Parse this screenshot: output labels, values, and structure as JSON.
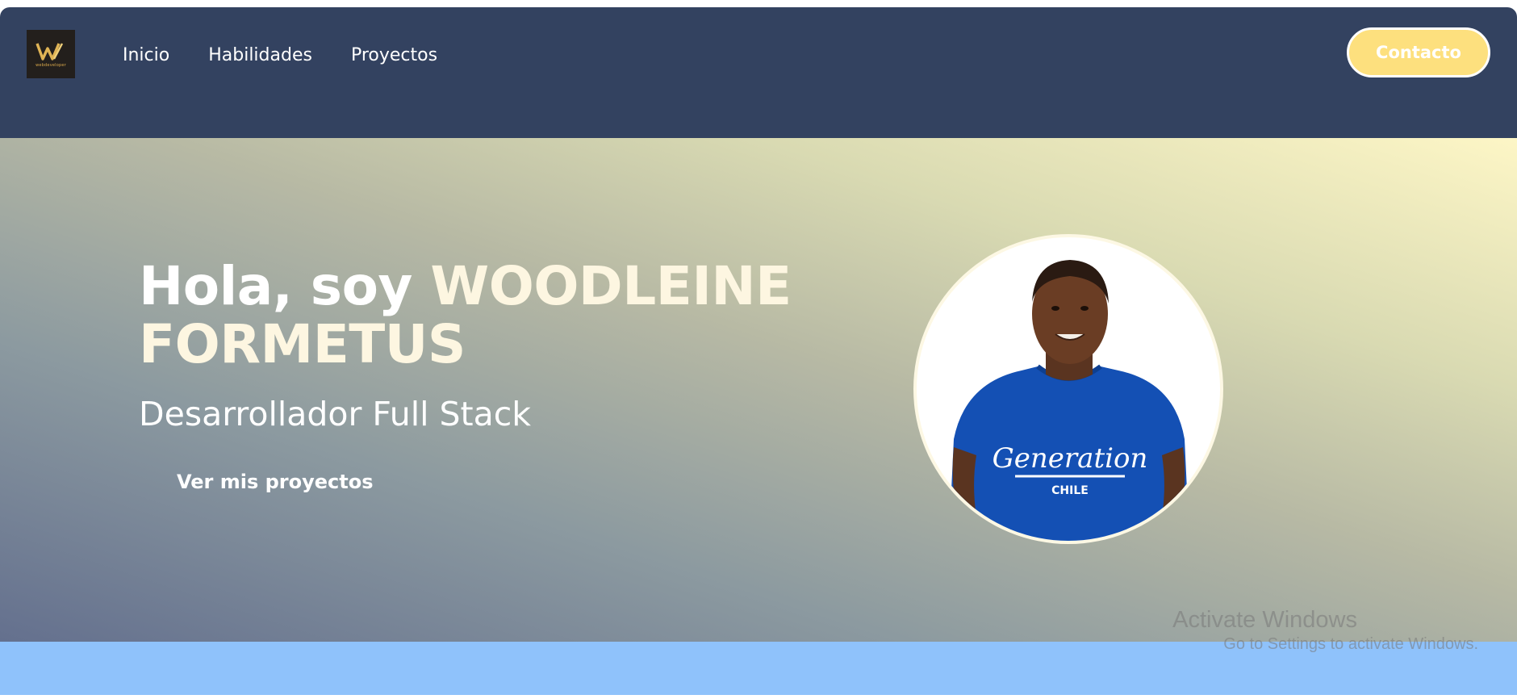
{
  "nav": {
    "logo_icon": "webdeveloper-logo",
    "logo_text": "webdeveloper",
    "links": [
      "Inicio",
      "Habilidades",
      "Proyectos"
    ],
    "contact_label": "Contacto"
  },
  "hero": {
    "greeting": "Hola, soy ",
    "name": "WOODLEINE FORMETUS",
    "subtitle": "Desarrollador Full Stack",
    "cta_label": "Ver mis proyectos",
    "photo": {
      "shirt_brand": "Generation",
      "shirt_country": "CHILE"
    }
  },
  "os_watermark": {
    "title": "Activate Windows",
    "subtitle": "Go to Settings to activate Windows."
  },
  "colors": {
    "navbar": "#334260",
    "accent_yellow": "#fde07e",
    "name_color": "#fdf6e1",
    "bottom_band": "#8fc2fb"
  }
}
